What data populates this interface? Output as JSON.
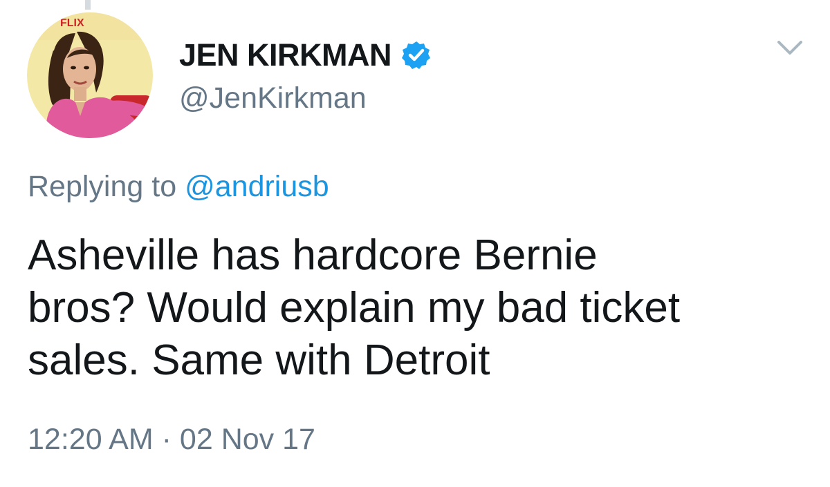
{
  "tweet": {
    "author": {
      "display_name": "JEN KIRKMAN",
      "handle": "@JenKirkman",
      "verified": true,
      "avatar_banner_text": "FLIX"
    },
    "reply": {
      "prefix": "Replying to",
      "mention": "@andriusb"
    },
    "text": "Asheville has hardcore Bernie bros? Would explain my bad ticket sales. Same with Detroit",
    "lines": [
      "Asheville has hardcore Bernie",
      "bros? Would explain my bad ticket",
      "sales. Same with Detroit"
    ],
    "time": "12:20 AM",
    "separator": "·",
    "date": "02 Nov 17"
  },
  "icons": {
    "verified": "verified-badge-icon",
    "menu": "chevron-down-icon"
  },
  "colors": {
    "primary_text": "#14171a",
    "secondary_text": "#657786",
    "link": "#1b95e0",
    "verified_blue": "#1da1f2"
  }
}
